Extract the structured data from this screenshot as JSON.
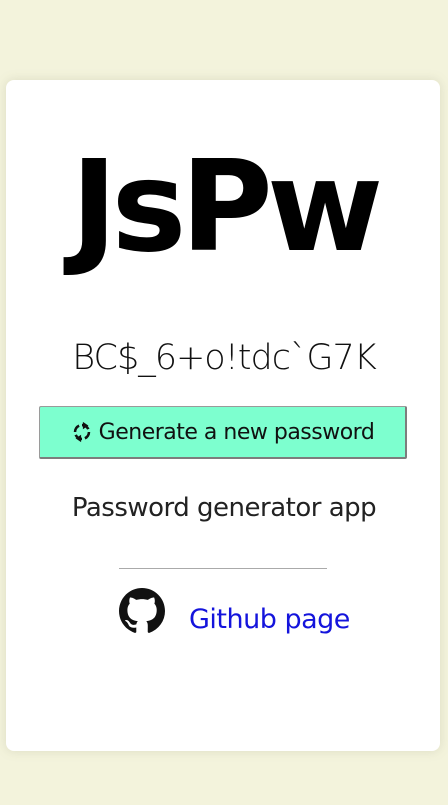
{
  "app": {
    "title": "JsPw",
    "password": "BC$_6+o!tdc`G7K",
    "generate_button_label": "Generate a new password",
    "subtitle": "Password generator app",
    "github_link_label": "Github page"
  },
  "icons": {
    "refresh": "refresh-icon",
    "github": "github-icon"
  },
  "colors": {
    "background": "#f3f3dc",
    "card": "#ffffff",
    "button": "#7dffcf",
    "link": "#1414dc"
  }
}
